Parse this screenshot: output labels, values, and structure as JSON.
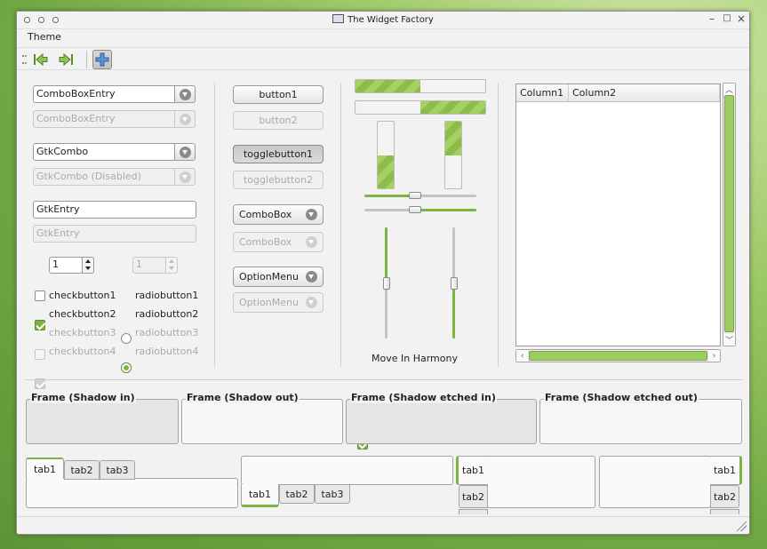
{
  "window": {
    "title": "The Widget Factory"
  },
  "menubar": {
    "items": [
      "Theme"
    ]
  },
  "toolbar": {
    "back_icon": "goto-first-icon",
    "forward_icon": "goto-last-icon",
    "add_icon": "add-icon"
  },
  "combos": {
    "entry1": "ComboBoxEntry",
    "entry1_dis": "ComboBoxEntry",
    "gtkcombo": "GtkCombo",
    "gtkcombo_dis": "GtkCombo (Disabled)",
    "gtkentry": "GtkEntry",
    "gtkentry_dis": "GtkEntry"
  },
  "spin": {
    "value": "1",
    "value_dis": "1"
  },
  "checks": [
    {
      "label": "checkbutton1",
      "checked": false,
      "disabled": false
    },
    {
      "label": "checkbutton2",
      "checked": true,
      "disabled": false
    },
    {
      "label": "checkbutton3",
      "checked": false,
      "disabled": true
    },
    {
      "label": "checkbutton4",
      "checked": true,
      "disabled": true
    }
  ],
  "radios": [
    {
      "label": "radiobutton1",
      "selected": false,
      "disabled": false
    },
    {
      "label": "radiobutton2",
      "selected": true,
      "disabled": false
    },
    {
      "label": "radiobutton3",
      "selected": false,
      "disabled": true
    },
    {
      "label": "radiobutton4",
      "selected": true,
      "disabled": true
    }
  ],
  "buttons": {
    "button1": "button1",
    "button2": "button2",
    "toggle1": "togglebutton1",
    "toggle2": "togglebutton2",
    "combobox": "ComboBox",
    "combobox_dis": "ComboBox",
    "optionmenu": "OptionMenu",
    "optionmenu_dis": "OptionMenu"
  },
  "progress": {
    "hbar1_fraction": 0.5,
    "hbar2_fraction": 0.5,
    "vbar1_fraction": 0.5,
    "vbar2_fraction": 0.5
  },
  "scales": {
    "h1_value": 0.45,
    "h2_value": 0.45,
    "v1_value": 0.5,
    "v2_value": 0.5
  },
  "harmony": {
    "label": "Move In Harmony",
    "checked": true
  },
  "tree": {
    "columns": [
      "Column1",
      "Column2"
    ]
  },
  "frames": [
    {
      "label": "Frame (Shadow in)"
    },
    {
      "label": "Frame (Shadow out)"
    },
    {
      "label": "Frame (Shadow etched in)"
    },
    {
      "label": "Frame (Shadow etched out)"
    }
  ],
  "tabs": {
    "top": [
      "tab1",
      "tab2",
      "tab3"
    ],
    "bottom": [
      "tab1",
      "tab2",
      "tab3"
    ],
    "left": [
      "tab1",
      "tab2"
    ],
    "right": [
      "tab1",
      "tab2"
    ]
  },
  "colors": {
    "accent": "#7cb342",
    "accent_light": "#a6d162"
  }
}
